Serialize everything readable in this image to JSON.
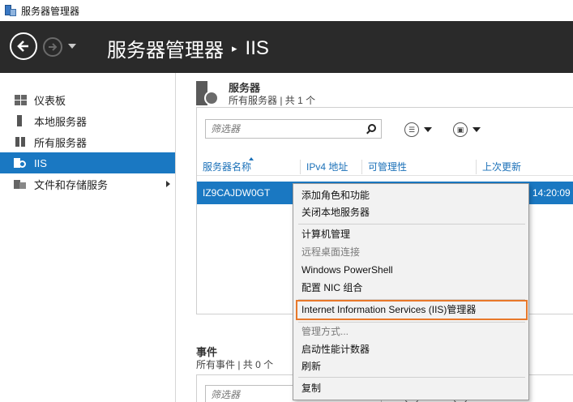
{
  "window": {
    "title": "服务器管理器"
  },
  "header": {
    "breadcrumb_root": "服务器管理器",
    "breadcrumb_sep": "▸",
    "breadcrumb_current": "IIS"
  },
  "sidebar": {
    "items": [
      {
        "label": "仪表板",
        "icon": "dashboard-icon"
      },
      {
        "label": "本地服务器",
        "icon": "local-server-icon"
      },
      {
        "label": "所有服务器",
        "icon": "all-servers-icon"
      },
      {
        "label": "IIS",
        "icon": "iis-icon",
        "selected": true
      },
      {
        "label": "文件和存储服务",
        "icon": "file-storage-icon",
        "has_children": true
      }
    ]
  },
  "servers": {
    "title": "服务器",
    "subtitle": "所有服务器 | 共 1 个",
    "filter_placeholder": "筛选器",
    "columns": [
      "服务器名称",
      "IPv4 地址",
      "可管理性",
      "上次更新"
    ],
    "row": {
      "name": "IZ9CAJDW0GT",
      "time": "14:20:09"
    }
  },
  "events": {
    "title": "事件",
    "subtitle": "所有事件 | 共 0 个",
    "filter_placeholder": "筛选器"
  },
  "context_menu": {
    "items": [
      {
        "label": "添加角色和功能"
      },
      {
        "label": "关闭本地服务器"
      },
      {
        "label": "计算机管理"
      },
      {
        "label": "远程桌面连接",
        "disabled": true
      },
      {
        "label": "Windows PowerShell"
      },
      {
        "label": "配置 NIC 组合"
      },
      {
        "label": "Internet Information Services (IIS)管理器",
        "highlighted": true
      },
      {
        "label": "管理方式...",
        "disabled": true
      },
      {
        "label": "启动性能计数器"
      },
      {
        "label": "刷新"
      },
      {
        "label": "复制"
      }
    ]
  },
  "colors": {
    "header_bg": "#2a2a2a",
    "selection_blue": "#1a78c2",
    "link_blue": "#1a70b8",
    "highlight_orange": "#e8782a"
  }
}
